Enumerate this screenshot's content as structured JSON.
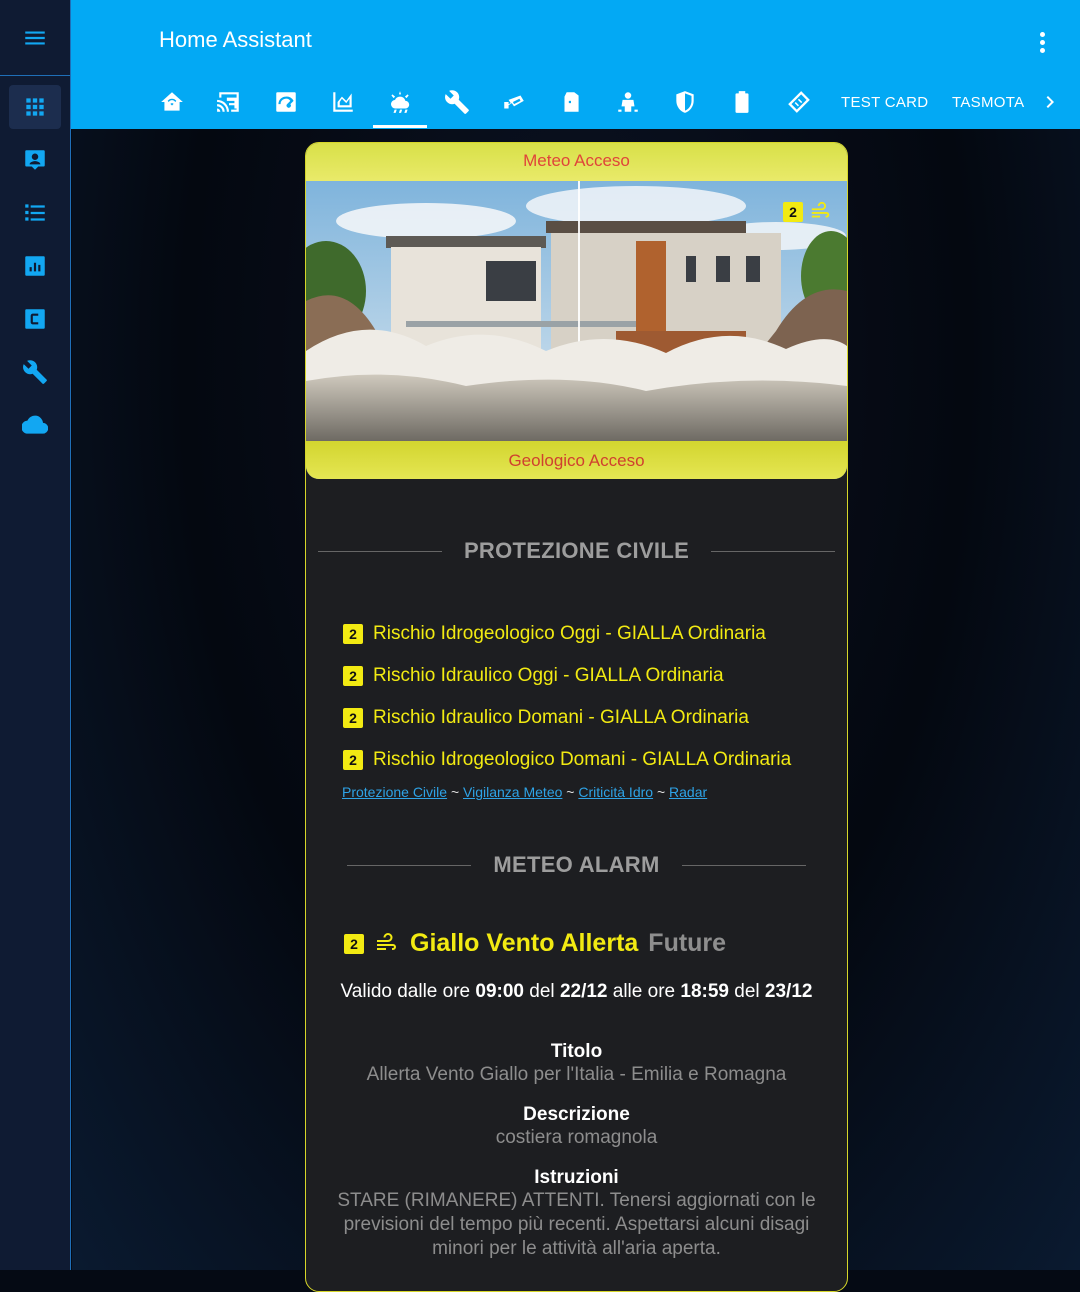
{
  "app": {
    "title": "Home Assistant"
  },
  "sidebar": {
    "items": [
      {
        "icon": "grid-icon",
        "active": true
      },
      {
        "icon": "account-box-icon"
      },
      {
        "icon": "list-icon"
      },
      {
        "icon": "chart-box-icon"
      },
      {
        "icon": "letter-c-box-icon"
      },
      {
        "icon": "wrench-icon"
      },
      {
        "icon": "cloud-icon"
      }
    ]
  },
  "tabs": {
    "icons": [
      "home-wifi-icon",
      "cast-icon",
      "gauge-icon",
      "area-chart-icon",
      "weather-icon",
      "wrench-icon",
      "cctv-icon",
      "door-icon",
      "person-icon",
      "shield-icon",
      "battery-icon",
      "tag-icon"
    ],
    "text_tabs": [
      "TEST CARD",
      "TASMOTA"
    ],
    "active_index": 4
  },
  "banner": {
    "top_label": "Meteo Acceso",
    "bottom_label": "Geologico Acceso",
    "level": "2"
  },
  "protezione": {
    "title": "PROTEZIONE CIVILE",
    "risks": [
      {
        "level": "2",
        "text": "Rischio Idrogeologico Oggi - GIALLA Ordinaria"
      },
      {
        "level": "2",
        "text": "Rischio Idraulico Oggi - GIALLA Ordinaria"
      },
      {
        "level": "2",
        "text": "Rischio Idraulico Domani - GIALLA Ordinaria"
      },
      {
        "level": "2",
        "text": "Rischio Idrogeologico Domani - GIALLA Ordinaria"
      }
    ],
    "links": [
      "Protezione Civile",
      "Vigilanza Meteo",
      "Criticità Idro",
      "Radar"
    ],
    "separator": "~"
  },
  "meteoalarm": {
    "title": "METEO ALARM",
    "level": "2",
    "alert_name": "Giallo Vento Allerta",
    "alert_status": "Future",
    "validity": {
      "prefix": "Valido dalle ore",
      "start_time": "09:00",
      "del1": "del",
      "start_date": "22/12",
      "middle": "alle ore",
      "end_time": "18:59",
      "del2": "del",
      "end_date": "23/12"
    },
    "titolo_label": "Titolo",
    "titolo_value": "Allerta Vento Giallo per l'Italia - Emilia e Romagna",
    "descrizione_label": "Descrizione",
    "descrizione_value": "costiera romagnola",
    "istruzioni_label": "Istruzioni",
    "istruzioni_value": "STARE (RIMANERE) ATTENTI. Tenersi aggiornati con le previsioni del tempo più recenti. Aspettarsi alcuni disagi minori per le attività all'aria aperta."
  },
  "colors": {
    "header": "#03a9f4",
    "sidebar": "#0f1b33",
    "accent_yellow": "#f2ea12",
    "card": "#1d1e21"
  }
}
